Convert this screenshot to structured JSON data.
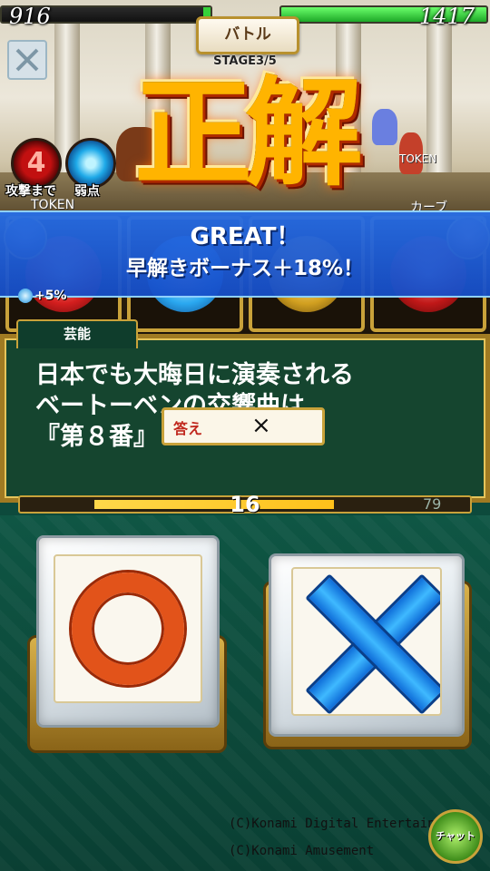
{
  "hud": {
    "player_hp": "916",
    "enemy_hp": "1417",
    "battle_label": "バトル",
    "stage": "STAGE3/5"
  },
  "effects": {
    "result_text": "正解",
    "great_title": "GREAT！",
    "great_subtitle": "早解きボーナス＋18%！"
  },
  "status": {
    "attack_countdown": "4",
    "attack_label": "攻撃まで",
    "weak_label": "弱点",
    "token_left": "TOKEN",
    "token_right": "TOKEN",
    "enemy_name": "カーブ",
    "buff": "+5%"
  },
  "question": {
    "category": "芸能",
    "lines": [
      "日本でも大晦日に演奏される",
      "ベートーベンの交響曲は",
      "『第８番』"
    ],
    "answer_label": "答え",
    "answer_value": "×"
  },
  "timer": {
    "remaining": "16",
    "total": "79",
    "fill_fraction": 0.66
  },
  "choices": {
    "true_icon": "circle-maru-icon",
    "false_icon": "cross-batsu-icon"
  },
  "footer": {
    "copyright_1": "(C)Konami Digital Entertainment",
    "copyright_2": "(C)Konami Amusement",
    "chat_label": "チャット"
  },
  "colors": {
    "board_green": "#15452f",
    "gold_frame": "#c9a23a",
    "circle_orange": "#e2531a",
    "cross_blue": "#2f9bf0",
    "banner_blue": "#1e5ad0"
  }
}
